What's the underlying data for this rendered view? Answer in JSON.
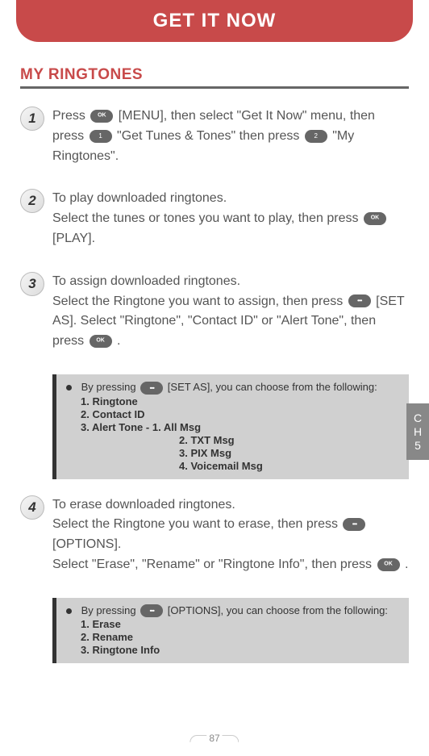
{
  "header": {
    "title": "GET IT NOW"
  },
  "section": {
    "title": "MY RINGTONES"
  },
  "steps": [
    {
      "num": "1",
      "parts": [
        "Press ",
        " [MENU], then select \"Get It Now\" menu, then press ",
        " \"Get Tunes & Tones\" then press ",
        " \"My Ringtones\"."
      ]
    },
    {
      "num": "2",
      "parts": [
        "To play downloaded ringtones.",
        "Select the tunes or tones you want to play, then press ",
        " [PLAY]."
      ]
    },
    {
      "num": "3",
      "parts": [
        "To assign downloaded ringtones.",
        "Select the Ringtone you want to assign, then press ",
        " [SET AS]. Select \"Ringtone\", \"Contact ID\" or \"Alert Tone\", then press ",
        " ."
      ]
    },
    {
      "num": "4",
      "parts": [
        "To erase downloaded ringtones.",
        "Select the Ringtone you want to erase, then press ",
        " [OPTIONS].",
        "Select \"Erase\", \"Rename\" or \"Ringtone Info\", then press ",
        " ."
      ]
    }
  ],
  "note1": {
    "intro_before": "By pressing ",
    "intro_after": " [SET AS], you can choose from the following:",
    "lines": [
      "1. Ringtone",
      "2. Contact ID",
      "3. Alert Tone -  1. All Msg",
      "2. TXT Msg",
      "3. PIX Msg",
      "4. Voicemail Msg"
    ]
  },
  "note2": {
    "intro_before": "By pressing ",
    "intro_after": " [OPTIONS], you can choose from the following:",
    "lines": [
      "1. Erase",
      "2. Rename",
      "3. Ringtone Info"
    ]
  },
  "side_tab": {
    "line1": "C",
    "line2": "H",
    "line3": "5"
  },
  "page_number": "87"
}
